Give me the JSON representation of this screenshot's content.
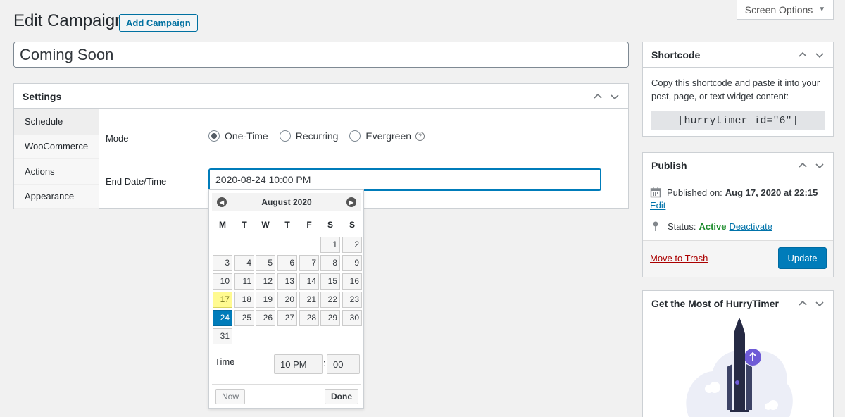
{
  "header": {
    "screen_options": "Screen Options",
    "page_title": "Edit Campaign",
    "add_button": "Add Campaign",
    "campaign_title": "Coming Soon"
  },
  "settings": {
    "title": "Settings",
    "tabs": [
      {
        "label": "Schedule"
      },
      {
        "label": "WooCommerce"
      },
      {
        "label": "Actions"
      },
      {
        "label": "Appearance"
      }
    ],
    "mode_label": "Mode",
    "modes": [
      {
        "label": "One-Time",
        "checked": true
      },
      {
        "label": "Recurring",
        "checked": false
      },
      {
        "label": "Evergreen",
        "checked": false
      }
    ],
    "end_label": "End Date/Time",
    "end_value": "2020-08-24 10:00 PM"
  },
  "datepicker": {
    "month": "August 2020",
    "weekdays": [
      "M",
      "T",
      "W",
      "T",
      "F",
      "S",
      "S"
    ],
    "days": [
      "1",
      "2",
      "3",
      "4",
      "5",
      "6",
      "7",
      "8",
      "9",
      "10",
      "11",
      "12",
      "13",
      "14",
      "15",
      "16",
      "17",
      "18",
      "19",
      "20",
      "21",
      "22",
      "23",
      "24",
      "25",
      "26",
      "27",
      "28",
      "29",
      "30",
      "31"
    ],
    "today": "17",
    "selected": "24",
    "time_label": "Time",
    "hour": "10 PM",
    "minute": "00",
    "now_button": "Now",
    "done_button": "Done"
  },
  "shortcode": {
    "title": "Shortcode",
    "description": "Copy this shortcode and paste it into your post, page, or text widget content:",
    "code": "[hurrytimer id=\"6\"]"
  },
  "publish": {
    "title": "Publish",
    "published_label": "Published on:",
    "published_date": "Aug 17, 2020 at 22:15",
    "edit_link": "Edit",
    "status_label": "Status:",
    "status_value": "Active",
    "deactivate_link": "Deactivate",
    "trash_link": "Move to Trash",
    "update_button": "Update"
  },
  "promo": {
    "title": "Get the Most of HurryTimer"
  },
  "colors": {
    "accent": "#007cba",
    "active": "#1e8d2e",
    "trash": "#a00000",
    "today": "#fffa90"
  }
}
